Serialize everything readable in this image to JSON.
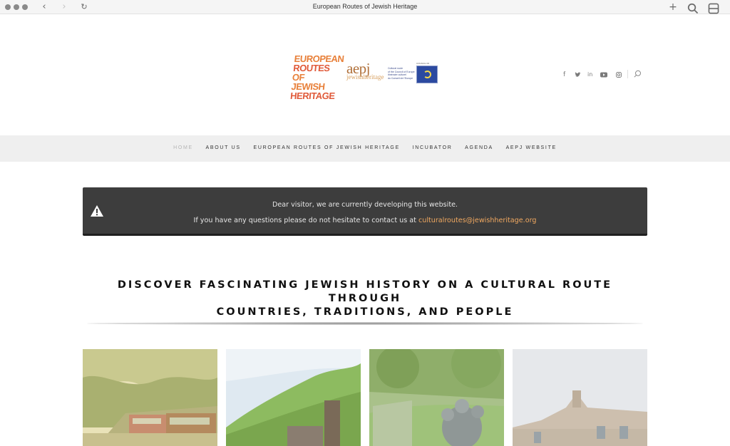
{
  "browser": {
    "tab_title": "European Routes of Jewish Heritage",
    "icons": [
      "back-icon",
      "forward-icon",
      "reload-icon",
      "new-tab-icon",
      "search-icon",
      "sidebar-icon"
    ]
  },
  "header": {
    "logo_ert_lines": [
      "EUROPEAN",
      "ROUTES",
      "OF JEWISH",
      "HERITAGE"
    ],
    "logo_aepj": "aepj",
    "logo_aepj_sub": "jewishheritage",
    "logo_aepj_caption": [
      "Cultural route",
      "of the Council of Europe",
      "Itinéraire culturel",
      "du Conseil de l'Europe"
    ],
    "logo_coe_caption": "COUNCIL OF EUROPE",
    "social_icons": [
      "facebook-icon",
      "twitter-icon",
      "linkedin-icon",
      "youtube-icon",
      "instagram-icon"
    ]
  },
  "nav": {
    "items": [
      {
        "label": "HOME",
        "active": true
      },
      {
        "label": "ABOUT US",
        "active": false
      },
      {
        "label": "EUROPEAN ROUTES OF JEWISH HERITAGE",
        "active": false
      },
      {
        "label": "INCUBATOR",
        "active": false
      },
      {
        "label": "AGENDA",
        "active": false
      },
      {
        "label": "AEPJ WEBSITE",
        "active": false
      }
    ]
  },
  "notice": {
    "line1": "Dear visitor, we are currently developing this website.",
    "line2": "If you have any questions please do not hesitate to contact us at ",
    "email": "culturalroutes@jewishheritage.org",
    "icon": "warning-icon"
  },
  "main": {
    "headline_line1": "DISCOVER FASCINATING JEWISH HISTORY ON A CULTURAL ROUTE THROUGH",
    "headline_line2": "COUNTRIES, TRADITIONS, AND PEOPLE"
  },
  "colors": {
    "accent_orange": "#e8803a",
    "notice_bg": "#3d3d3d",
    "link": "#f0a860",
    "nav_bg": "#efefef"
  }
}
